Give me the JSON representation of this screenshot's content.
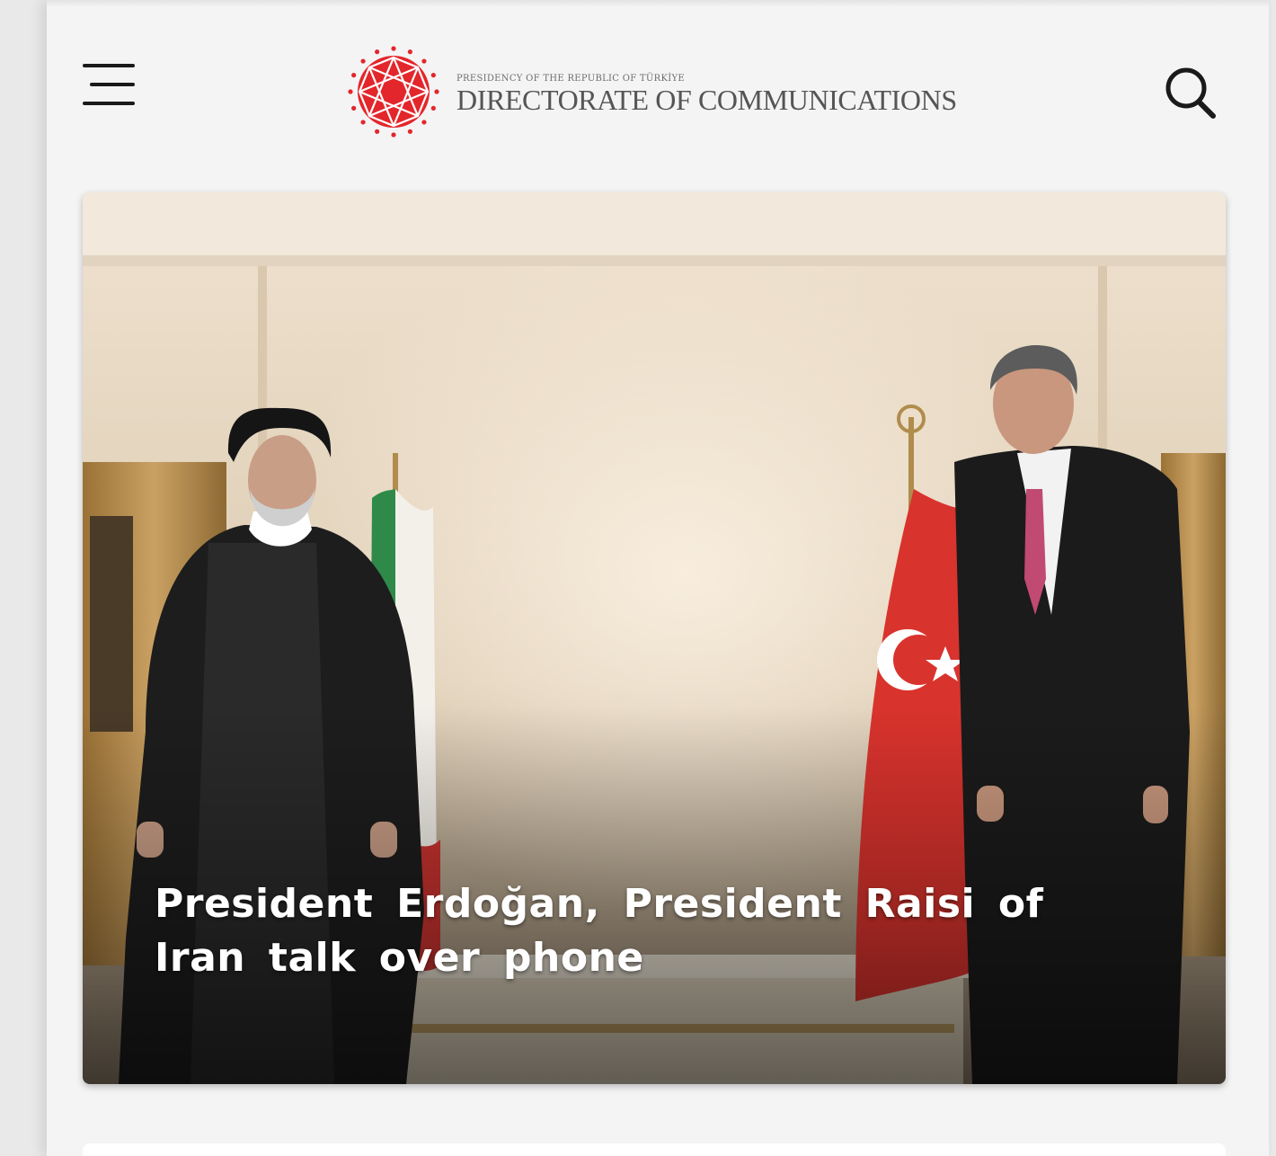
{
  "header": {
    "menu_icon": "hamburger-menu-icon",
    "logo": {
      "emblem_icon": "presidency-star-emblem-icon",
      "small_text": "PRESIDENCY OF THE REPUBLIC OF TÜRKİYE",
      "big_text": "DIRECTORATE OF COMMUNICATIONS",
      "color": "#e3262b"
    },
    "search_icon": "search-icon"
  },
  "hero": {
    "image": "photo of two presidents standing in front of Iranian and Turkish flags",
    "title": "President Erdoğan, President Raisi of Iran talk over phone"
  }
}
